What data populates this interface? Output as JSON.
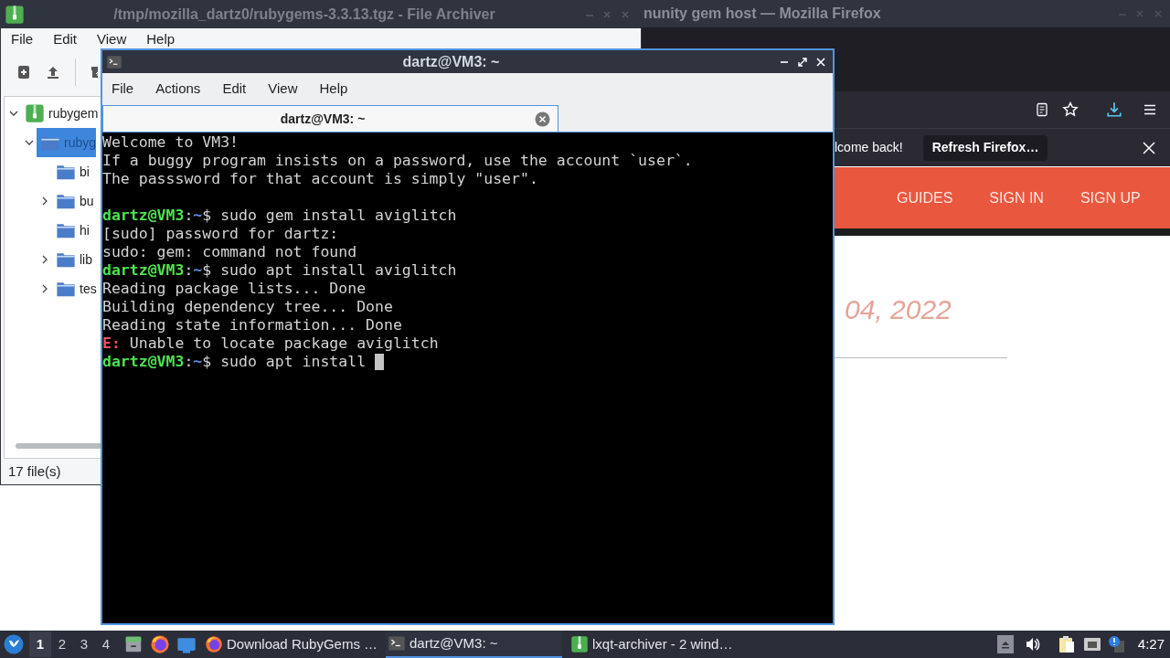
{
  "archiver": {
    "title": "/tmp/mozilla_dartz0/rubygems-3.3.13.tgz - File Archiver",
    "menu": [
      "File",
      "Edit",
      "View",
      "Help"
    ],
    "tree": [
      {
        "label": "rubygem",
        "kind": "archive",
        "expanded": true,
        "selected": false,
        "children": [
          {
            "label": "rubyg",
            "kind": "folder",
            "expanded": true,
            "selected": true,
            "children": [
              {
                "label": "bi",
                "kind": "folder",
                "selected": false
              },
              {
                "label": "bu",
                "kind": "folder",
                "expanded": false,
                "selected": false
              },
              {
                "label": "hi",
                "kind": "folder",
                "selected": false
              },
              {
                "label": "lib",
                "kind": "folder",
                "expanded": false,
                "selected": false
              },
              {
                "label": "tes",
                "kind": "folder",
                "expanded": false,
                "selected": false
              }
            ]
          }
        ]
      }
    ],
    "status": "17 file(s)"
  },
  "firefox": {
    "title": "nunity gem host — Mozilla Firefox",
    "notification": {
      "message": "lcome back!",
      "button": "Refresh Firefox…"
    },
    "nav": [
      "GUIDES",
      "SIGN IN",
      "SIGN UP"
    ],
    "date": "04, 2022"
  },
  "terminal": {
    "title": "dartz@VM3: ~",
    "menu": [
      "File",
      "Actions",
      "Edit",
      "View",
      "Help"
    ],
    "tabs": [
      {
        "label": "dartz@VM3: ~",
        "selected": true
      }
    ],
    "lines": [
      {
        "kind": "text",
        "cursor": false,
        "segments": [
          {
            "kind": "plain",
            "text": "Welcome to VM3!"
          }
        ]
      },
      {
        "kind": "text",
        "cursor": false,
        "segments": [
          {
            "kind": "plain",
            "text": "If a buggy program insists on a password, use the account `user`."
          }
        ]
      },
      {
        "kind": "text",
        "cursor": false,
        "segments": [
          {
            "kind": "plain",
            "text": "The passsword for that account is simply \"user\"."
          }
        ]
      },
      {
        "kind": "blank",
        "cursor": false
      },
      {
        "kind": "text",
        "cursor": false,
        "segments": [
          {
            "kind": "user",
            "text": "dartz@VM3"
          },
          {
            "kind": "plain",
            "text": ":"
          },
          {
            "kind": "path",
            "text": "~"
          },
          {
            "kind": "plain",
            "text": "$ sudo gem install aviglitch"
          }
        ]
      },
      {
        "kind": "text",
        "cursor": false,
        "segments": [
          {
            "kind": "plain",
            "text": "[sudo] password for dartz:"
          }
        ]
      },
      {
        "kind": "text",
        "cursor": false,
        "segments": [
          {
            "kind": "plain",
            "text": "sudo: gem: command not found"
          }
        ]
      },
      {
        "kind": "text",
        "cursor": false,
        "segments": [
          {
            "kind": "user",
            "text": "dartz@VM3"
          },
          {
            "kind": "plain",
            "text": ":"
          },
          {
            "kind": "path",
            "text": "~"
          },
          {
            "kind": "plain",
            "text": "$ sudo apt install aviglitch"
          }
        ]
      },
      {
        "kind": "text",
        "cursor": false,
        "segments": [
          {
            "kind": "plain",
            "text": "Reading package lists... Done"
          }
        ]
      },
      {
        "kind": "text",
        "cursor": false,
        "segments": [
          {
            "kind": "plain",
            "text": "Building dependency tree... Done"
          }
        ]
      },
      {
        "kind": "text",
        "cursor": false,
        "segments": [
          {
            "kind": "plain",
            "text": "Reading state information... Done"
          }
        ]
      },
      {
        "kind": "text",
        "cursor": false,
        "segments": [
          {
            "kind": "error",
            "text": "E:"
          },
          {
            "kind": "plain",
            "text": " Unable to locate package aviglitch"
          }
        ]
      },
      {
        "kind": "text",
        "cursor": true,
        "segments": [
          {
            "kind": "user",
            "text": "dartz@VM3"
          },
          {
            "kind": "plain",
            "text": ":"
          },
          {
            "kind": "path",
            "text": "~"
          },
          {
            "kind": "plain",
            "text": "$ sudo apt install "
          }
        ]
      }
    ]
  },
  "taskbar": {
    "desktops": [
      {
        "label": "1",
        "selected": true
      },
      {
        "label": "2",
        "selected": false
      },
      {
        "label": "3",
        "selected": false
      },
      {
        "label": "4",
        "selected": false
      }
    ],
    "launchers": [
      {
        "kind": "files"
      },
      {
        "kind": "firefox"
      },
      {
        "kind": "desktop"
      }
    ],
    "tasks": [
      {
        "label": "Download RubyGems …",
        "kind": "firefox",
        "selected": false
      },
      {
        "label": "dartz@VM3: ~",
        "kind": "terminal",
        "selected": true
      },
      {
        "label": "lxqt-archiver - 2 wind…",
        "kind": "archive",
        "selected": false
      }
    ],
    "clock": "4:27"
  }
}
